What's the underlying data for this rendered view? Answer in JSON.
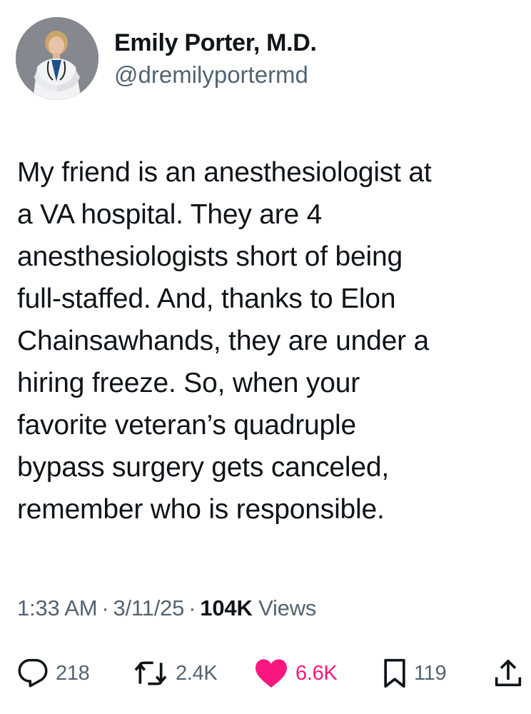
{
  "author": {
    "name": "Emily Porter, M.D.",
    "handle": "@dremilyportermd"
  },
  "tweet": {
    "lines": [
      "My friend is an anesthesiologist at",
      "a VA hospital. They are 4",
      "anesthesiologists short of being",
      "full-staffed. And, thanks to Elon",
      "Chainsawhands, they are under a",
      "hiring freeze. So, when your",
      "favorite veteran’s quadruple",
      "bypass surgery gets canceled,",
      "remember who is responsible."
    ]
  },
  "meta": {
    "time": "1:33 AM",
    "separator": "·",
    "date": "3/11/25",
    "views_count": "104K",
    "views_label": "Views"
  },
  "actions": {
    "replies": {
      "icon": "reply-icon",
      "count": "218"
    },
    "reposts": {
      "icon": "repost-icon",
      "count": "2.4K"
    },
    "likes": {
      "icon": "heart-icon",
      "count": "6.6K",
      "color": "#f91880"
    },
    "bookmarks": {
      "icon": "bookmark-icon",
      "count": "119"
    },
    "share": {
      "icon": "share-icon"
    }
  },
  "colors": {
    "text": "#0f1419",
    "secondary": "#536471",
    "like": "#f91880"
  }
}
